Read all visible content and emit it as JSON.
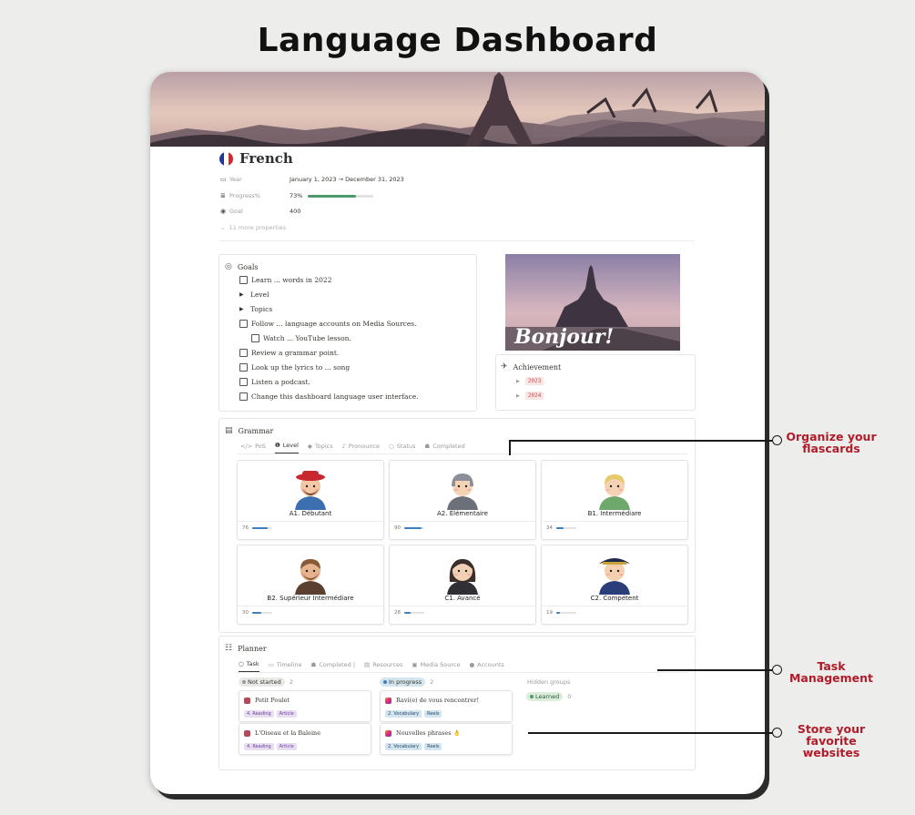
{
  "heading": "Language Dashboard",
  "page": {
    "title": "French",
    "properties": [
      {
        "icon": "calendar-icon",
        "name": "Year",
        "value": "January 1, 2023 → December 31, 2023"
      },
      {
        "icon": "progress-icon",
        "name": "Progress%",
        "value": "73%",
        "progress": 0.73
      },
      {
        "icon": "goal-icon",
        "name": "Goal",
        "value": "400"
      }
    ],
    "more_properties": "11 more properties"
  },
  "goals": {
    "title": "Goals",
    "items": [
      {
        "type": "checkbox",
        "label": "Learn ... words in 2022",
        "indent": 0
      },
      {
        "type": "toggle",
        "label": "Level",
        "indent": 0
      },
      {
        "type": "toggle",
        "label": "Topics",
        "indent": 0
      },
      {
        "type": "checkbox",
        "label": "Follow ... language accounts on Media Sources.",
        "indent": 0
      },
      {
        "type": "checkbox",
        "label": "Watch ... YouTube lesson.",
        "indent": 1
      },
      {
        "type": "checkbox",
        "label": "Review a grammar point.",
        "indent": 0
      },
      {
        "type": "checkbox",
        "label": "Look up the lyrics to ... song",
        "indent": 0
      },
      {
        "type": "checkbox",
        "label": "Listen a podcast.",
        "indent": 0
      },
      {
        "type": "checkbox",
        "label": "Change this dashboard language user interface.",
        "indent": 0
      }
    ]
  },
  "photo_caption": "Bonjour!",
  "achievement": {
    "title": "Achievement",
    "items": [
      "2023",
      "2024"
    ]
  },
  "grammar": {
    "title": "Grammar",
    "tabs": [
      "PoS",
      "Level",
      "Topics",
      "Pronounce",
      "Status",
      "Completed"
    ],
    "active_tab": "Level",
    "cards": [
      {
        "name": "A1. Débutant",
        "count": "76",
        "progress": 0.75
      },
      {
        "name": "A2. Élémentaire",
        "count": "90",
        "progress": 0.85
      },
      {
        "name": "B1. Intermédiare",
        "count": "34",
        "progress": 0.35
      },
      {
        "name": "B2. Supérieur Intermédiare",
        "count": "30",
        "progress": 0.45
      },
      {
        "name": "C1. Avancé",
        "count": "28",
        "progress": 0.3
      },
      {
        "name": "C2. Compétent",
        "count": "19",
        "progress": 0.2
      }
    ]
  },
  "planner": {
    "title": "Planner",
    "tabs": [
      "Task",
      "Timeline",
      "Completed |",
      "Resources",
      "Media Source",
      "Accounts"
    ],
    "active_tab": "Task",
    "groups": [
      {
        "label": "Not started",
        "count": "2",
        "cards": [
          {
            "title": "Petit Poulet",
            "tag1": "4. Reading",
            "tag2": "Article"
          },
          {
            "title": "L'Oiseau et la Baleine",
            "tag1": "4. Reading",
            "tag2": "Article"
          }
        ]
      },
      {
        "label": "In progress",
        "count": "2",
        "cards": [
          {
            "title": "Ravi(e) de vous rencontrer!",
            "tag1": "2. Vocabulary",
            "tag2": "Reels"
          },
          {
            "title": "Nouvelles phrases 👌",
            "tag1": "2. Vocabulary",
            "tag2": "Reels"
          }
        ]
      }
    ],
    "hidden_groups_label": "Hidden groups",
    "hidden_group": {
      "label": "Learned",
      "count": "0"
    }
  },
  "annotations": {
    "flashcards": [
      "Organize your",
      "flascards"
    ],
    "task": [
      "Task",
      "Management"
    ],
    "websites": [
      "Store your",
      "favorite",
      "websites"
    ]
  },
  "colors": {
    "accent_red": "#b01c2a",
    "progress_green": "#4c9a6a",
    "progress_blue": "#3d7fbf"
  }
}
